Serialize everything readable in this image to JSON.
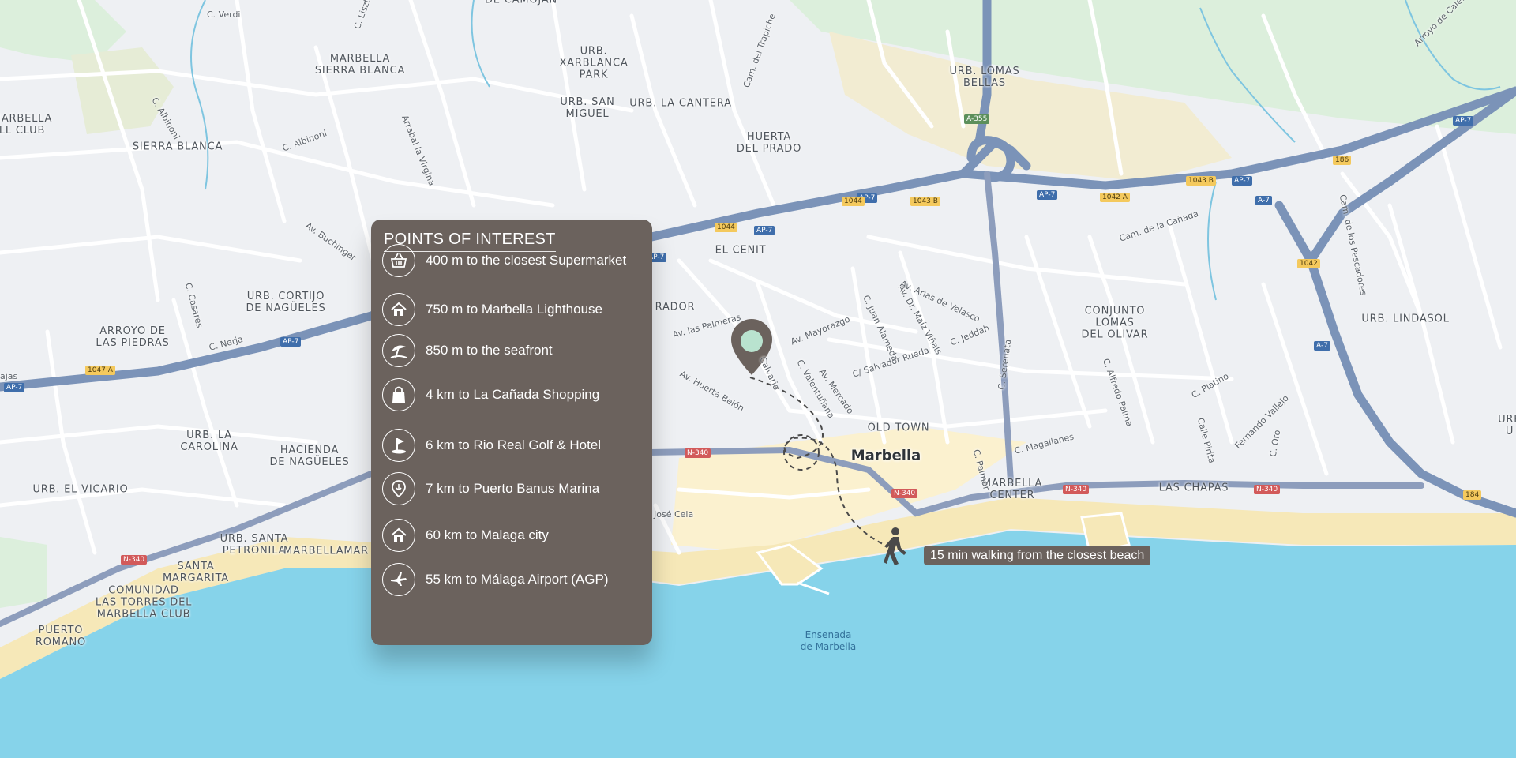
{
  "panel": {
    "title": "POINTS OF INTEREST",
    "items": [
      {
        "icon": "shopping-basket-icon",
        "text": "400 m to the closest Supermarket"
      },
      {
        "icon": "home-icon",
        "text": "750 m to Marbella Lighthouse"
      },
      {
        "icon": "beach-umbrella-icon",
        "text": "850 m to the seafront"
      },
      {
        "icon": "shopping-bag-icon",
        "text": "4 km to La Cañada Shopping"
      },
      {
        "icon": "golf-flag-icon",
        "text": "6 km to Rio Real Golf & Hotel"
      },
      {
        "icon": "marina-pin-icon",
        "text": "7 km to Puerto Banus Marina"
      },
      {
        "icon": "home-icon",
        "text": "60 km to Malaga city"
      },
      {
        "icon": "airplane-icon",
        "text": "55 km to Málaga Airport (AGP)"
      }
    ]
  },
  "walking_callout": "15 min walking from the closest beach",
  "colors": {
    "panel": "#6b625d",
    "sea": "#86d3ea",
    "highway": "#7b93b8",
    "beach": "#f6e8b8",
    "land": "#eef0f3",
    "park": "#dcefdc",
    "marker": "#6b625d",
    "marker_dot": "#b9e3cf"
  },
  "map": {
    "town": "Marbella",
    "water": "Ensenada\nde Marbella",
    "areas": [
      "MARBELLA\nSIERRA BLANCA",
      "URB.\nXARBLANCA\nPARK",
      "URB. SAN\nMIGUEL",
      "URB. LA CANTERA",
      "HUERTA\nDEL PRADO",
      "URB. LOMAS\nBELLAS",
      "SIERRA BLANCA",
      "MARBELLA\nLL CLUB",
      "URB. CORTIJO\nDE NAGÜELES",
      "ARROYO DE\nLAS PIEDRAS",
      "EL CENIT",
      "CONJUNTO\nLOMAS\nDEL OLIVAR",
      "URB. LINDASOL",
      "OLD TOWN",
      "URB. LA\nCAROLINA",
      "HACIENDA\nDE NAGÜELES",
      "URB. EL VICARIO",
      "MARBELLA\nCENTER",
      "LAS CHAPAS",
      "URB. SANTA\nPETRONILA",
      "MARBELLAMAR",
      "SANTA\nMARGARITA",
      "COMUNIDAD\nLAS TORRES DEL\nMARBELLA CLUB",
      "PUERTO\nROMANO",
      "RADOR",
      "DE CAMOJÁN",
      "URB\nU"
    ],
    "streets": [
      "C. Verdi",
      "C. Liszt",
      "Cam. del Trapiche",
      "C. Albinoni",
      "C. Albinoni",
      "Arrabal la Virgina",
      "Av. Buchinger",
      "C. Casares",
      "C. Nerja",
      "Av. las Palmeras",
      "Av. Mayorazgo",
      "Av. Huerta Belón",
      "Calvario",
      "C. Valentuñana",
      "Av. Mercado",
      "C/ Salvador Rueda",
      "C. Juan Alameda",
      "Av. Dr. Maíz Viñals",
      "C. Jeddah",
      "Av. Arias de Velasco",
      "C. Serenata",
      "Cam. de la Cañada",
      "Cam. de los Pescadores",
      "C. Alfredo Palma",
      "C. Platino",
      "Calle Pirita",
      "C. Magallanes",
      "C. Palmar",
      "C. Oro",
      "Fernando Vallejo",
      "José Cela",
      "Arroyo de Calera",
      "ajas"
    ],
    "road_badges": [
      {
        "label": "AP-7",
        "kind": "ap"
      },
      {
        "label": "AP-7",
        "kind": "ap"
      },
      {
        "label": "AP-7",
        "kind": "ap"
      },
      {
        "label": "AP-7",
        "kind": "ap"
      },
      {
        "label": "AP-7",
        "kind": "ap"
      },
      {
        "label": "AP-7",
        "kind": "ap"
      },
      {
        "label": "AP-7",
        "kind": "ap"
      },
      {
        "label": "AP-7",
        "kind": "ap"
      },
      {
        "label": "A-7",
        "kind": "ap"
      },
      {
        "label": "A-7",
        "kind": "ap"
      },
      {
        "label": "A-355",
        "kind": "g"
      },
      {
        "label": "1044",
        "kind": "y"
      },
      {
        "label": "1044",
        "kind": "y"
      },
      {
        "label": "1043 B",
        "kind": "y"
      },
      {
        "label": "1043 B",
        "kind": "y"
      },
      {
        "label": "1042 A",
        "kind": "y"
      },
      {
        "label": "186",
        "kind": "y"
      },
      {
        "label": "1042",
        "kind": "y"
      },
      {
        "label": "184",
        "kind": "y"
      },
      {
        "label": "1047 A",
        "kind": "y"
      },
      {
        "label": "N-340",
        "kind": "n"
      },
      {
        "label": "N-340",
        "kind": "n"
      },
      {
        "label": "N-340",
        "kind": "n"
      },
      {
        "label": "N-340",
        "kind": "n"
      },
      {
        "label": "N-340",
        "kind": "n"
      }
    ]
  }
}
